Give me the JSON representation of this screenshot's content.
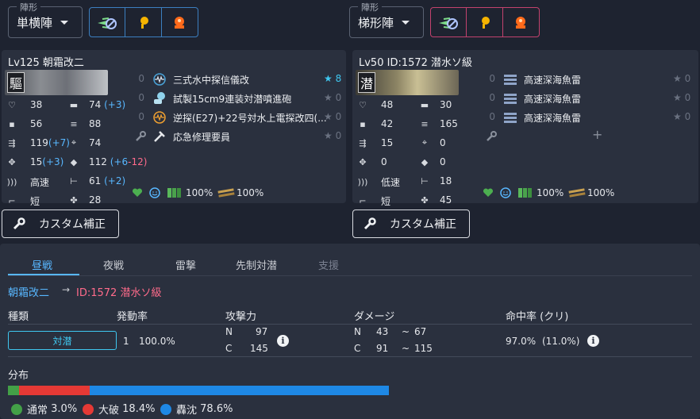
{
  "formation": {
    "legend": "陣形",
    "fleet1": {
      "value": "単横陣",
      "accent": "#3c7fc0"
    },
    "fleet2": {
      "value": "梯形陣",
      "accent": "#c2426e"
    },
    "buttons": [
      "no-aa-icon",
      "searchlight-icon",
      "alarm-icon"
    ]
  },
  "ship1": {
    "header": "Lv125  朝霜改二",
    "banner_kanji": "驅",
    "stats_left": [
      {
        "icon": "heart-icon",
        "value": "38"
      },
      {
        "icon": "armor-icon",
        "value": "56"
      },
      {
        "icon": "evasion-icon",
        "value": "119",
        "bonus": "(+7)"
      },
      {
        "icon": "plane-count-icon",
        "value": "15",
        "bonus": "(+3)"
      },
      {
        "icon": "speed-icon",
        "value": "高速"
      },
      {
        "icon": "range-icon",
        "value": "短"
      }
    ],
    "stats_right": [
      {
        "icon": "firepower-icon",
        "value": "74",
        "bonus": "(+3)"
      },
      {
        "icon": "torpedo-icon",
        "value": "88"
      },
      {
        "icon": "aa-icon",
        "value": "74"
      },
      {
        "icon": "asw-icon",
        "value": "112",
        "bonus": "(+6",
        "bonus2": "-12)"
      },
      {
        "icon": "los-icon",
        "value": "61",
        "bonus": "(+2)"
      },
      {
        "icon": "luck-icon",
        "value": "28"
      }
    ],
    "equipment": [
      {
        "lv": "0",
        "name": "三式水中探信儀改",
        "star": "★ 8",
        "star_on": true
      },
      {
        "lv": "0",
        "name": "試製15cm9連装対潜噴進砲",
        "star": "★ 0"
      },
      {
        "lv": "0",
        "name": "逆探(E27)+22号対水上電探改四(...",
        "star": "★ 0"
      },
      {
        "lv": "",
        "name": "応急修理要員",
        "star": "★ 0"
      }
    ],
    "footer": {
      "fuel": "100%",
      "ammo": "100%"
    }
  },
  "ship2": {
    "header": "Lv50   ID:1572 潜水ソ級",
    "banner_kanji": "潜",
    "stats_left": [
      {
        "icon": "heart-icon",
        "value": "48"
      },
      {
        "icon": "armor-icon",
        "value": "42"
      },
      {
        "icon": "evasion-icon",
        "value": "15"
      },
      {
        "icon": "plane-count-icon",
        "value": "0"
      },
      {
        "icon": "speed-icon",
        "value": "低速"
      },
      {
        "icon": "range-icon",
        "value": "短"
      }
    ],
    "stats_right": [
      {
        "icon": "firepower-icon",
        "value": "30"
      },
      {
        "icon": "torpedo-icon",
        "value": "165"
      },
      {
        "icon": "aa-icon",
        "value": "0"
      },
      {
        "icon": "asw-icon",
        "value": "0"
      },
      {
        "icon": "los-icon",
        "value": "18"
      },
      {
        "icon": "luck-icon",
        "value": "45"
      }
    ],
    "equipment": [
      {
        "lv": "0",
        "name": "高速深海魚雷",
        "star": "★ 0"
      },
      {
        "lv": "0",
        "name": "高速深海魚雷",
        "star": "★ 0"
      },
      {
        "lv": "0",
        "name": "高速深海魚雷",
        "star": "★ 0"
      }
    ],
    "add_slot": "+",
    "footer": {
      "fuel": "100%",
      "ammo": "100%"
    }
  },
  "custom_button": "カスタム補正",
  "tabs": [
    {
      "label": "昼戦",
      "state": "active"
    },
    {
      "label": "夜戦",
      "state": "inactive"
    },
    {
      "label": "雷撃",
      "state": "inactive"
    },
    {
      "label": "先制対潜",
      "state": "inactive"
    },
    {
      "label": "支援",
      "state": "disabled"
    }
  ],
  "matchup": {
    "attacker": "朝霜改二",
    "arrow": "→",
    "defender": "ID:1572 潜水ソ級"
  },
  "table": {
    "headers": [
      "種類",
      "発動率",
      "攻撃力",
      "ダメージ",
      "命中率 (クリ)"
    ],
    "row": {
      "type": "対潜",
      "rate_idx": "1",
      "rate": "100.0%",
      "power_n_label": "N",
      "power_n": "97",
      "power_c_label": "C",
      "power_c": "145",
      "dmg_n_label": "N",
      "dmg_n_min": "43",
      "dmg_n_sep": "~",
      "dmg_n_max": "67",
      "dmg_c_label": "C",
      "dmg_c_min": "91",
      "dmg_c_sep": "~",
      "dmg_c_max": "115",
      "hit": "97.0%",
      "crit": "(11.0%)"
    }
  },
  "distribution": {
    "title": "分布",
    "segments": [
      {
        "label": "通常",
        "value": "3.0%",
        "color": "#43a047",
        "pct": 3.0
      },
      {
        "label": "大破",
        "value": "18.4%",
        "color": "#e53935",
        "pct": 18.4
      },
      {
        "label": "轟沈",
        "value": "78.6%",
        "color": "#1e88e5",
        "pct": 78.6
      }
    ]
  }
}
